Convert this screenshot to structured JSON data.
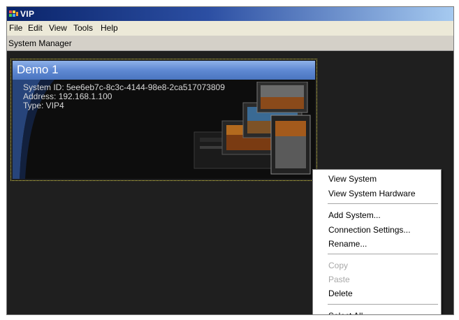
{
  "window": {
    "title": "VIP"
  },
  "menubar": {
    "items": [
      "File",
      "Edit",
      "View",
      "Tools",
      "Help"
    ]
  },
  "panel": {
    "title": "System Manager"
  },
  "system_card": {
    "name": "Demo 1",
    "system_id": "System ID: 5ee6eb7c-8c3c-4144-98e8-2ca517073809",
    "address": "Address: 192.168.1.100",
    "type": "Type: VIP4"
  },
  "context_menu": {
    "view_system": "View System",
    "view_system_hardware": "View System Hardware",
    "add_system": "Add System...",
    "connection_settings": "Connection Settings...",
    "rename": "Rename...",
    "copy": "Copy",
    "paste": "Paste",
    "delete": "Delete",
    "select_all": "Select All"
  },
  "colors": {
    "title_gradient_start": "#0a246a",
    "title_gradient_end": "#a6caf0",
    "card_header": "#5f89d3",
    "card_selection_border": "#e3d84a",
    "workspace_background": "#1f1f1f"
  }
}
